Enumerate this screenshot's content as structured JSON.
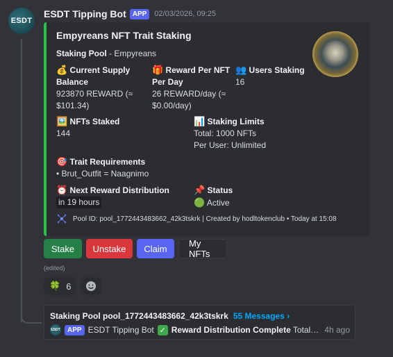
{
  "message": {
    "avatar_text": "ESDT",
    "author": "ESDT Tipping Bot",
    "app_badge": "APP",
    "timestamp": "02/03/2026, 09:25",
    "edited": "(edited)"
  },
  "embed": {
    "accent_color": "#26c24a",
    "title": "Empyreans NFT Trait Staking",
    "pool_label": "Staking Pool",
    "pool_value": " - Empyreans",
    "fields": {
      "supply": {
        "emoji": "💰",
        "name": "Current Supply Balance",
        "value": "923870 REWARD (≈ $101.34)"
      },
      "reward": {
        "emoji": "🎁",
        "name": "Reward Per NFT Per Day",
        "value": "26 REWARD/day (≈ $0.00/day)"
      },
      "users": {
        "emoji": "👥",
        "name": "Users Staking",
        "value": "16"
      },
      "nfts": {
        "emoji": "🖼️",
        "name": "NFTs Staked",
        "value": "144"
      },
      "limits": {
        "emoji": "📊",
        "name": "Staking Limits",
        "value_line1": "Total: 1000 NFTs",
        "value_line2": "Per User: Unlimited"
      },
      "trait": {
        "emoji": "🎯",
        "name": "Trait Requirements",
        "value": "• Brut_Outfit = Naagnimo"
      },
      "next": {
        "emoji": "⏰",
        "name": "Next Reward Distribution",
        "value": "in 19 hours"
      },
      "status": {
        "emoji": "📌",
        "name": "Status",
        "status_emoji": "🟢",
        "value": "Active"
      }
    },
    "footer": {
      "icon": "network-icon",
      "text": "Pool ID: pool_1772443483662_42k3tskrk | Created by hodltokenclub • Today at 15:08"
    }
  },
  "buttons": {
    "stake": "Stake",
    "unstake": "Unstake",
    "claim": "Claim",
    "my_nfts": "My NFTs"
  },
  "reactions": {
    "clover_emoji": "🍀",
    "clover_count": "6",
    "add_reaction_icon": "smiley-icon"
  },
  "thread": {
    "title": "Staking Pool pool_1772443483662_42k3tskrk",
    "messages_link": "55 Messages ›",
    "last_avatar_text": "ESDT",
    "last_badge": "APP",
    "last_author": "ESDT Tipping Bot",
    "last_bold": "Reward Distribution Complete",
    "last_text": "Total r...",
    "last_time": "4h ago"
  },
  "colors": {
    "background": "#323339",
    "embed_bg": "#2b2d31",
    "green": "#248046",
    "red": "#da373c",
    "blurple": "#5865f2",
    "link": "#00a8fc"
  }
}
